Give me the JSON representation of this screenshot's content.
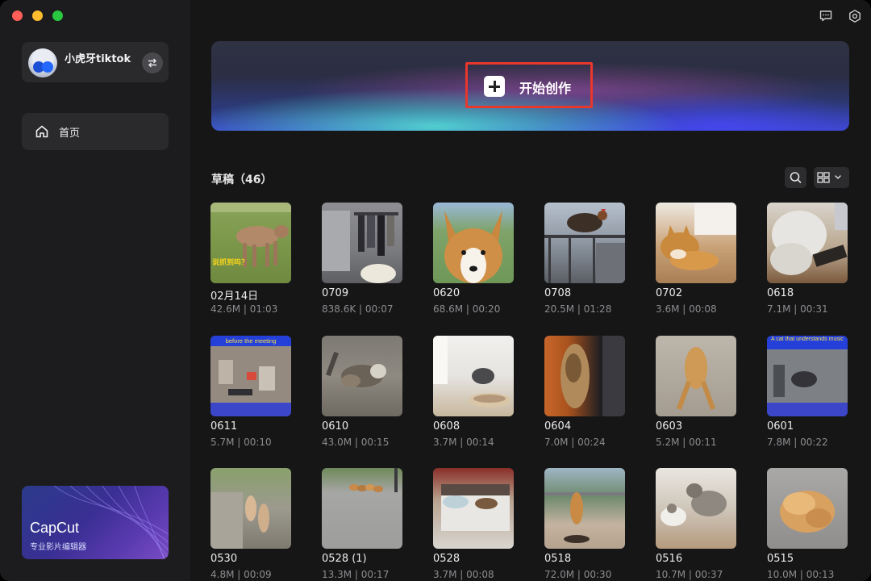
{
  "sidebar": {
    "account_name": "小虎牙tiktok",
    "switch_icon": "swap-arrows-icon",
    "nav": [
      {
        "label": "首页",
        "icon": "home-icon"
      }
    ],
    "promo": {
      "brand": "CapCut",
      "subtitle": "专业影片编辑器"
    }
  },
  "toolbar": {
    "icons": [
      "feedback-icon",
      "settings-icon"
    ]
  },
  "banner": {
    "create_label": "开始创作",
    "icon": "plus-icon",
    "highlight_color": "#e8372c"
  },
  "drafts": {
    "title": "草稿（46）",
    "search_icon": "search-icon",
    "view_icon": "grid-view-icon",
    "items": [
      {
        "name": "02月14日",
        "meta": "42.6M | 01:03",
        "overlay": "说抓到吗？"
      },
      {
        "name": "0709",
        "meta": "838.6K | 00:07"
      },
      {
        "name": "0620",
        "meta": "68.6M | 00:20"
      },
      {
        "name": "0708",
        "meta": "20.5M | 01:28"
      },
      {
        "name": "0702",
        "meta": "3.6M | 00:08"
      },
      {
        "name": "0618",
        "meta": "7.1M | 00:31"
      },
      {
        "name": "0611",
        "meta": "5.7M | 00:10",
        "overlay": "before the meeting"
      },
      {
        "name": "0610",
        "meta": "43.0M | 00:15"
      },
      {
        "name": "0608",
        "meta": "3.7M | 00:14"
      },
      {
        "name": "0604",
        "meta": "7.0M | 00:24"
      },
      {
        "name": "0603",
        "meta": "5.2M | 00:11"
      },
      {
        "name": "0601",
        "meta": "7.8M | 00:22",
        "overlay": "A cat that understands music"
      },
      {
        "name": "0530",
        "meta": "4.8M | 00:09"
      },
      {
        "name": "0528 (1)",
        "meta": "13.3M | 00:17"
      },
      {
        "name": "0528",
        "meta": "3.7M | 00:08"
      },
      {
        "name": "0518",
        "meta": "72.0M | 00:30"
      },
      {
        "name": "0516",
        "meta": "10.7M | 00:37"
      },
      {
        "name": "0515",
        "meta": "10.0M | 00:13"
      }
    ]
  }
}
